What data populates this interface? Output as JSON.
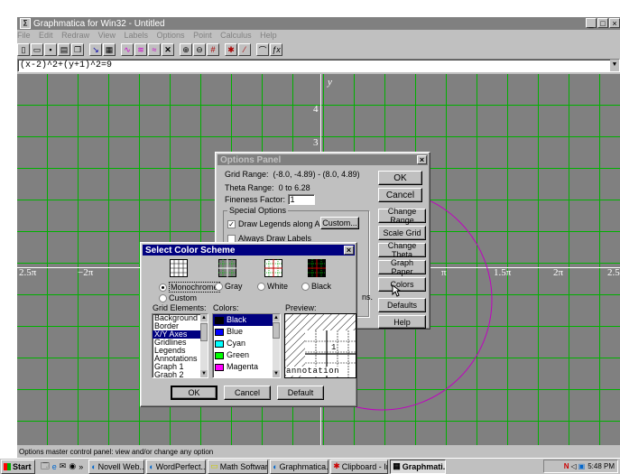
{
  "window": {
    "title": "Graphmatica for Win32 - Untitled"
  },
  "menu": [
    "File",
    "Edit",
    "Redraw",
    "View",
    "Labels",
    "Options",
    "Point",
    "Calculus",
    "Help"
  ],
  "equation": {
    "value": "(x-2)^2+(y+1)^2=9"
  },
  "graph": {
    "y_label": "y",
    "y_ticks": [
      "4",
      "3"
    ],
    "x_ticks": [
      "2.5π",
      "−2π",
      "π",
      "1.5π",
      "2π",
      "2.5"
    ],
    "circle_color": "#c000c0",
    "grid_color": "#00b000",
    "bg_color": "#808080"
  },
  "options_panel": {
    "title": "Options Panel",
    "grid_range_label": "Grid Range:",
    "grid_range_value": "(-8.0, -4.89) - (8.0, 4.89)",
    "theta_range_label": "Theta Range:",
    "theta_range_value": "0 to 6.28",
    "fineness_label": "Fineness Factor:",
    "fineness_value": "1",
    "special_options_label": "Special Options",
    "draw_legends_label": "Draw Legends along Axes",
    "custom_button": "Custom...",
    "always_draw_labels": "Always Draw Labels",
    "partial_text": "ns.",
    "buttons": {
      "ok": "OK",
      "cancel": "Cancel",
      "change_range": "Change Range",
      "scale_grid": "Scale Grid",
      "change_theta": "Change Theta",
      "graph_paper": "Graph Paper",
      "colors": "Colors",
      "defaults": "Defaults",
      "help": "Help"
    }
  },
  "color_scheme": {
    "title": "Select Color Scheme",
    "schemes": [
      "Monochrome",
      "Gray",
      "White",
      "Black"
    ],
    "selected_scheme": "Monochrome",
    "custom_label": "Custom",
    "grid_elements_label": "Grid Elements:",
    "grid_elements": [
      "Background",
      "Border",
      "X/Y Axes",
      "Gridlines",
      "Legends",
      "Annotations",
      "Graph 1",
      "Graph 2"
    ],
    "selected_element": "X/Y Axes",
    "colors_label": "Colors:",
    "colors": [
      {
        "name": "Black",
        "hex": "#000000"
      },
      {
        "name": "Blue",
        "hex": "#0000ff"
      },
      {
        "name": "Cyan",
        "hex": "#00ffff"
      },
      {
        "name": "Green",
        "hex": "#00ff00"
      },
      {
        "name": "Magenta",
        "hex": "#ff00ff"
      }
    ],
    "selected_color": "Black",
    "preview_label": "Preview:",
    "preview_number": "1",
    "preview_text": "annotation",
    "buttons": {
      "ok": "OK",
      "cancel": "Cancel",
      "default": "Default"
    }
  },
  "status_bar": {
    "text": "Options master control panel: view and/or change any option"
  },
  "taskbar": {
    "start": "Start",
    "chevron": "»",
    "tasks": [
      "Novell Web...",
      "WordPerfect...",
      "Math Software",
      "Graphmatica...",
      "Clipboard - Inf...",
      "Graphmati..."
    ],
    "active_task": "Graphmati...",
    "clock": "5:48 PM"
  }
}
